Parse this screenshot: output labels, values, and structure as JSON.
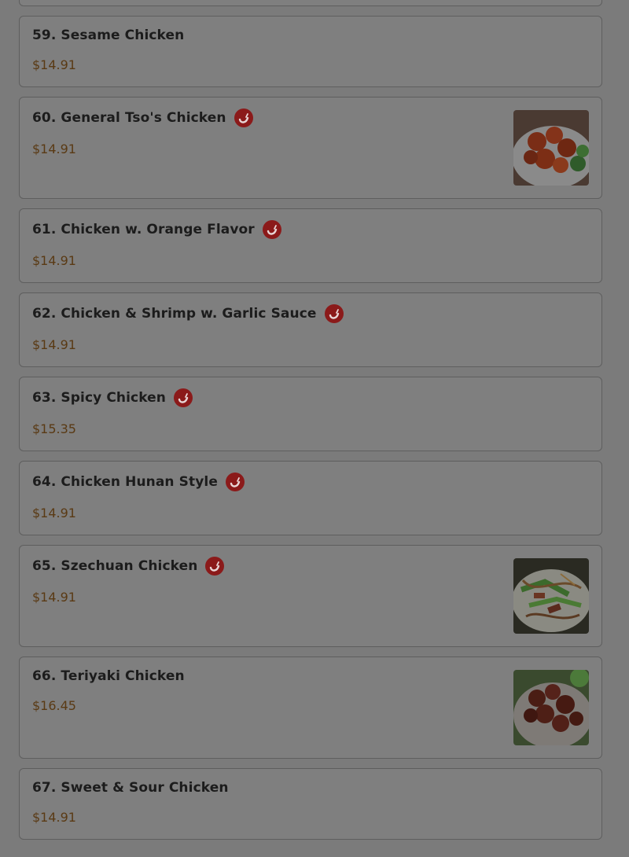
{
  "menu": {
    "items": [
      {
        "name": "59. Sesame Chicken",
        "price": "$14.91",
        "spicy": false,
        "image": false
      },
      {
        "name": "60. General Tso's Chicken",
        "price": "$14.91",
        "spicy": true,
        "image": true,
        "image_icon": "food-photo-general-tso"
      },
      {
        "name": "61. Chicken w. Orange Flavor",
        "price": "$14.91",
        "spicy": true,
        "image": false
      },
      {
        "name": "62. Chicken & Shrimp w. Garlic Sauce",
        "price": "$14.91",
        "spicy": true,
        "image": false
      },
      {
        "name": "63. Spicy Chicken",
        "price": "$15.35",
        "spicy": true,
        "image": false
      },
      {
        "name": "64. Chicken Hunan Style",
        "price": "$14.91",
        "spicy": true,
        "image": false
      },
      {
        "name": "65. Szechuan Chicken",
        "price": "$14.91",
        "spicy": true,
        "image": true,
        "image_icon": "food-photo-szechuan"
      },
      {
        "name": "66. Teriyaki Chicken",
        "price": "$16.45",
        "spicy": false,
        "image": true,
        "image_icon": "food-photo-teriyaki"
      },
      {
        "name": "67. Sweet & Sour Chicken",
        "price": "$14.91",
        "spicy": false,
        "image": false
      }
    ]
  },
  "colors": {
    "overlay_background": "#7b7b7b",
    "title_text": "#1c1c1c",
    "price_text": "#5a3a14",
    "spicy_badge": "#8b1a1a"
  },
  "icons": {
    "spicy": "chili-pepper-icon"
  }
}
